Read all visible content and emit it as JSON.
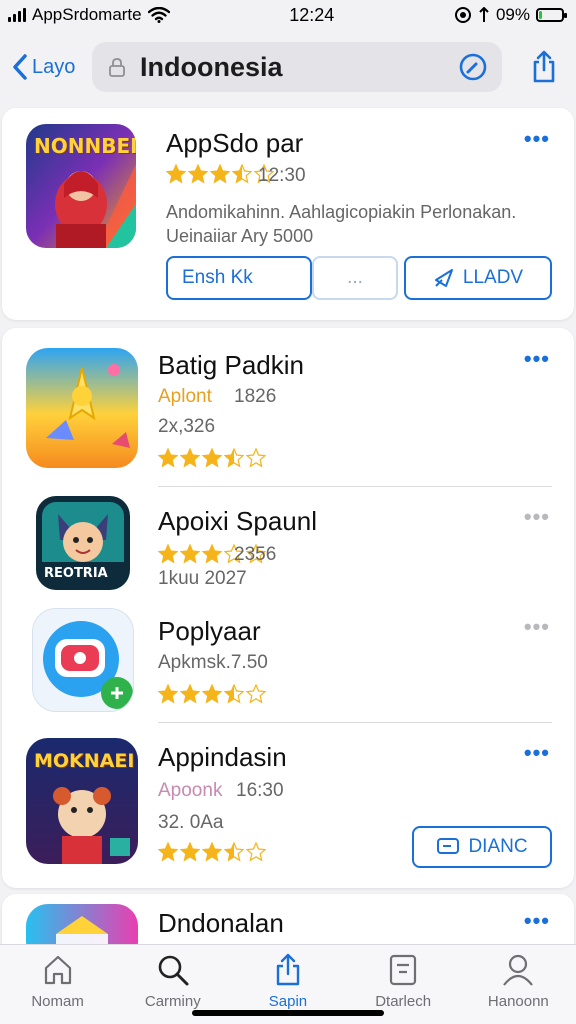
{
  "status": {
    "carrier": "AppSrdomarte",
    "time": "12:24",
    "battery_text": "09%",
    "battery_level": 0.09
  },
  "nav": {
    "back_label": "Layo",
    "search_value": "Indoonesia"
  },
  "featured": {
    "icon_text": "NONNBEI",
    "title": "AppSdo par",
    "rating_text": "12:30",
    "rating": 3.5,
    "description_line1": "Andomikahinn. Aahlagicopiakin Perlonakan.",
    "description_line2": "Ueinaiiar Ary 5000",
    "button_left": "Ensh Kk",
    "button_middle": "...",
    "button_right": "LLADV"
  },
  "apps": [
    {
      "title": "Batig Padkin",
      "sub1_accent": "Aplont",
      "sub1": "1826",
      "sub2": "2x,326",
      "rating": 3.5,
      "dots_color": "#1a6fd8"
    },
    {
      "title": "Apoixi Spaunl",
      "sub1_accent": "",
      "sub1": "2356",
      "sub2": "1kuu 2027",
      "rating": 3,
      "dots_color": "#b9b9bd",
      "icon_text": "REOTRIA"
    },
    {
      "title": "Poplyaar",
      "sub1_accent": "",
      "sub1": "Apkmsk.7.50",
      "sub2": "",
      "rating": 3.5,
      "dots_color": "#b9b9bd"
    },
    {
      "title": "Appindasin",
      "sub1_accent": "Apoonk",
      "sub1": "16:30",
      "sub2": "32. 0Aa",
      "rating": 3.5,
      "dots_color": "#1a6fd8",
      "icon_text": "MOKNAEI",
      "button": "DIANC"
    }
  ],
  "partial_app": {
    "title": "Dndonalan"
  },
  "tabs": [
    {
      "label": "Nomam",
      "icon": "home-icon"
    },
    {
      "label": "Carminy",
      "icon": "search-icon"
    },
    {
      "label": "Sapin",
      "icon": "share-icon",
      "active": true
    },
    {
      "label": "Dtarlech",
      "icon": "document-icon"
    },
    {
      "label": "Hanoonn",
      "icon": "person-icon"
    }
  ],
  "colors": {
    "accent": "#1a6fd8",
    "star": "#f5b41a"
  }
}
